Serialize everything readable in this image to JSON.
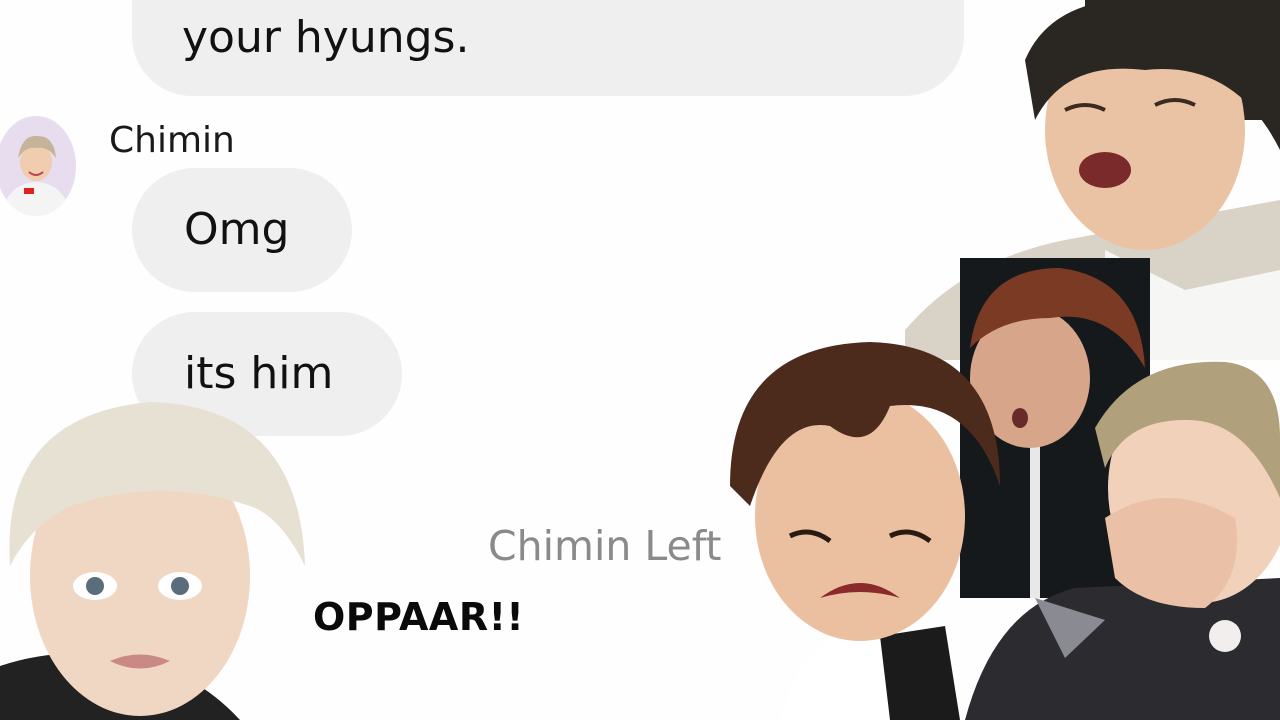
{
  "chat": {
    "messages": [
      {
        "text": "your hyungs."
      },
      {
        "text": "Omg"
      },
      {
        "text": "its him"
      }
    ],
    "sender": {
      "name": "Chimin"
    },
    "system_message": "Chimin Left"
  },
  "caption": {
    "text": "OPPAAR!!"
  },
  "colors": {
    "bubble": "#efefef",
    "background": "#fefefe",
    "system_text": "#8a8a8a"
  }
}
